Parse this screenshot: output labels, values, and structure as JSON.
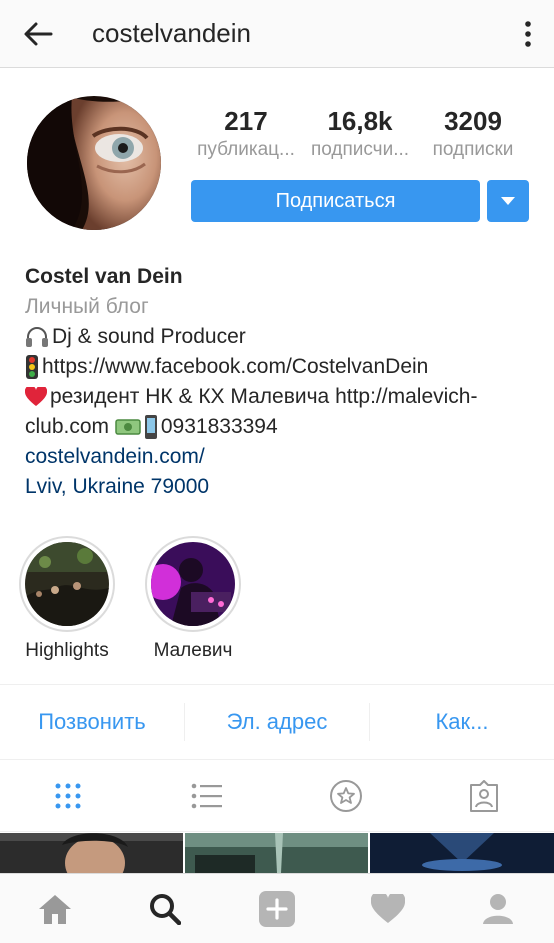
{
  "header": {
    "username": "costelvandein"
  },
  "stats": [
    {
      "value": "217",
      "label": "публикац..."
    },
    {
      "value": "16,8k",
      "label": "подписчи..."
    },
    {
      "value": "3209",
      "label": "подписки"
    }
  ],
  "actions": {
    "follow_label": "Подписаться"
  },
  "bio": {
    "name": "Costel van Dein",
    "category": "Личный блог",
    "line1": "Dj & sound Producer",
    "line2": "https://www.facebook.com/CostelvanDein",
    "line3": "резидент НК & КХ Малевича http://malevich-",
    "line4": "club.com",
    "phone": "0931833394",
    "website": "costelvandein.com/",
    "location": "Lviv, Ukraine 79000"
  },
  "highlights": [
    {
      "label": "Highlights"
    },
    {
      "label": "Малевич"
    }
  ],
  "contact": {
    "call": "Позвонить",
    "email": "Эл. адрес",
    "directions": "Как..."
  },
  "colors": {
    "accent": "#3897f0",
    "link": "#003569",
    "muted": "#999999",
    "text": "#262626"
  },
  "icons": {
    "view_tabs": [
      "grid-icon",
      "list-icon",
      "saved-star-icon",
      "tagged-icon"
    ],
    "bottom_nav": [
      "home-icon",
      "search-icon",
      "add-icon",
      "heart-icon",
      "profile-icon"
    ]
  }
}
